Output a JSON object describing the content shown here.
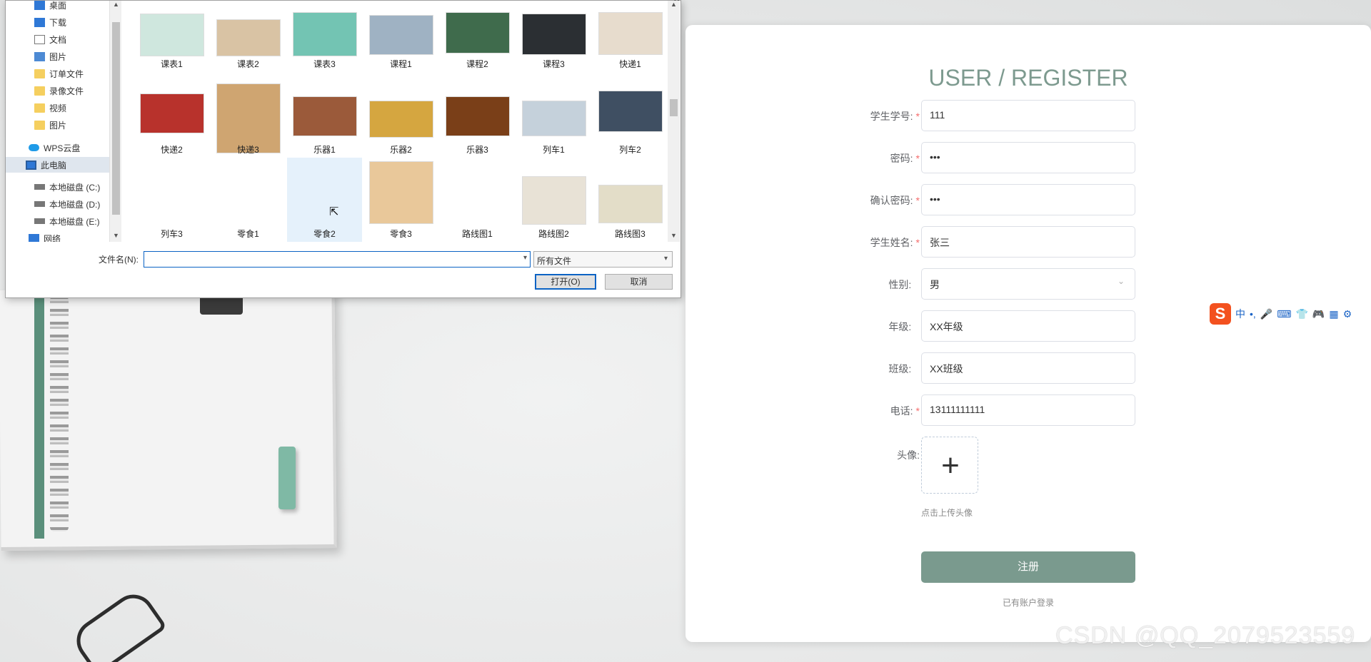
{
  "dialog": {
    "nav_items": [
      {
        "label": "桌面",
        "icon": "desktop-icon",
        "pinned": true
      },
      {
        "label": "下载",
        "icon": "download-icon",
        "pinned": true
      },
      {
        "label": "文档",
        "icon": "document-icon",
        "pinned": true
      },
      {
        "label": "图片",
        "icon": "picture-icon",
        "pinned": true
      },
      {
        "label": "订单文件",
        "icon": "folder-icon"
      },
      {
        "label": "录像文件",
        "icon": "folder-icon"
      },
      {
        "label": "视频",
        "icon": "folder-icon"
      },
      {
        "label": "图片",
        "icon": "folder-icon"
      },
      {
        "label": "WPS云盘",
        "icon": "cloud-icon"
      },
      {
        "label": "此电脑",
        "icon": "computer-icon",
        "selected": true
      },
      {
        "label": "本地磁盘 (C:)",
        "icon": "drive-icon"
      },
      {
        "label": "本地磁盘 (D:)",
        "icon": "drive-icon"
      },
      {
        "label": "本地磁盘 (E:)",
        "icon": "drive-icon"
      },
      {
        "label": "网络",
        "icon": "network-icon"
      }
    ],
    "files": [
      {
        "label": "课表1",
        "color": "#cfe7de"
      },
      {
        "label": "课表2",
        "color": "#d9c3a4"
      },
      {
        "label": "课表3",
        "color": "#73c4b3"
      },
      {
        "label": "课程1",
        "color": "#9fb2c3"
      },
      {
        "label": "课程2",
        "color": "#3f6b4c"
      },
      {
        "label": "课程3",
        "color": "#2b2f33"
      },
      {
        "label": "快递1",
        "color": "#e7dccd"
      },
      {
        "label": "快递2",
        "color": "#b8322c"
      },
      {
        "label": "快递3",
        "color": "#cfa571"
      },
      {
        "label": "乐器1",
        "color": "#9b5a3a"
      },
      {
        "label": "乐器2",
        "color": "#d5a640"
      },
      {
        "label": "乐器3",
        "color": "#7a3f18"
      },
      {
        "label": "列车1",
        "color": "#c5d1db"
      },
      {
        "label": "列车2",
        "color": "#3f4f62"
      },
      {
        "label": "列车3",
        "color": ""
      },
      {
        "label": "零食1",
        "color": ""
      },
      {
        "label": "零食2",
        "color": "",
        "selected": true
      },
      {
        "label": "零食3",
        "color": "#e9c89a"
      },
      {
        "label": "路线图1",
        "color": ""
      },
      {
        "label": "路线图2",
        "color": "#e8e2d6"
      },
      {
        "label": "路线图3",
        "color": "#e3ddc8"
      }
    ],
    "filename_label": "文件名(N):",
    "filename_value": "",
    "filetype_value": "所有文件",
    "open_label": "打开(O)",
    "cancel_label": "取消"
  },
  "register": {
    "title": "USER / REGISTER",
    "fields": [
      {
        "label": "学生学号:",
        "required": true,
        "value": "111"
      },
      {
        "label": "密码:",
        "required": true,
        "value": "•••"
      },
      {
        "label": "确认密码:",
        "required": true,
        "value": "•••"
      },
      {
        "label": "学生姓名:",
        "required": true,
        "value": "张三"
      },
      {
        "label": "性别:",
        "required": false,
        "value": "男",
        "select": true
      },
      {
        "label": "年级:",
        "required": false,
        "value": "XX年级"
      },
      {
        "label": "班级:",
        "required": false,
        "value": "XX班级"
      },
      {
        "label": "电话:",
        "required": true,
        "value": "13111111111"
      }
    ],
    "avatar_label": "头像:",
    "upload_tip": "点击上传头像",
    "submit_label": "注册",
    "login_link": "已有账户登录"
  },
  "ime": {
    "items": [
      "中",
      "•,",
      "mic",
      "keyboard",
      "skin",
      "game",
      "grid",
      "settings"
    ]
  },
  "watermark": "CSDN @QQ_2079523559",
  "colors": {
    "accent": "#7a9a8e",
    "title": "#7d9a8f",
    "required": "#f56c6c",
    "dialog_focus": "#0b63c4"
  }
}
